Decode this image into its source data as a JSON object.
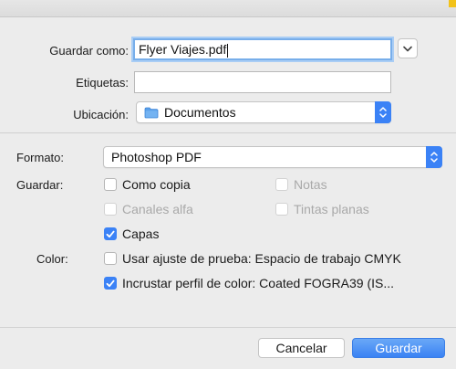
{
  "dialog": {
    "save_as_label": "Guardar como:",
    "save_as_value": "Flyer Viajes.pdf",
    "tags_label": "Etiquetas:",
    "tags_value": "",
    "location_label": "Ubicación:",
    "location_value": "Documentos",
    "location_icon": "folder-icon"
  },
  "options": {
    "format_label": "Formato:",
    "format_value": "Photoshop PDF",
    "save_label": "Guardar:",
    "as_copy": {
      "label": "Como copia",
      "checked": false,
      "enabled": true
    },
    "notes": {
      "label": "Notas",
      "checked": false,
      "enabled": false
    },
    "alpha_channels": {
      "label": "Canales alfa",
      "checked": false,
      "enabled": false
    },
    "spot_colors": {
      "label": "Tintas planas",
      "checked": false,
      "enabled": false
    },
    "layers": {
      "label": "Capas",
      "checked": true,
      "enabled": true
    },
    "color_label": "Color:",
    "use_proof_setup": {
      "label": "Usar ajuste de prueba: Espacio de trabajo CMYK",
      "checked": false,
      "enabled": true
    },
    "embed_profile": {
      "label": "Incrustar perfil de color: Coated FOGRA39 (IS...",
      "checked": true,
      "enabled": true
    }
  },
  "buttons": {
    "cancel": "Cancelar",
    "save": "Guardar"
  },
  "colors": {
    "accent": "#3b82f6",
    "background": "#ececec",
    "focus_ring": "#78aeea"
  }
}
